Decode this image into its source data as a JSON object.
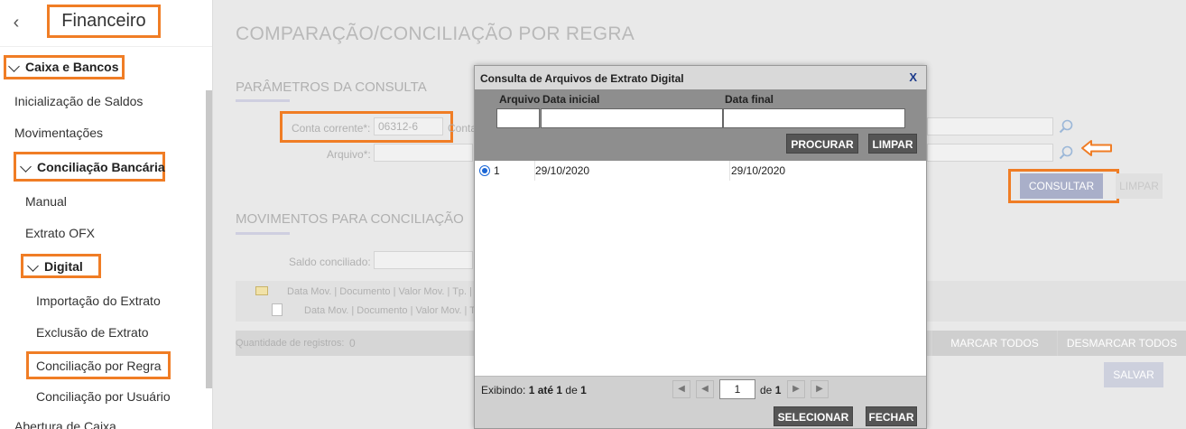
{
  "sidebar": {
    "title": "Financeiro",
    "items": [
      {
        "label": "Caixa e Bancos"
      },
      {
        "label": "Inicialização de Saldos"
      },
      {
        "label": "Movimentações"
      },
      {
        "label": "Conciliação Bancária"
      },
      {
        "label": "Manual"
      },
      {
        "label": "Extrato OFX"
      },
      {
        "label": "Digital"
      },
      {
        "label": "Importação do Extrato"
      },
      {
        "label": "Exclusão de Extrato"
      },
      {
        "label": "Conciliação por Regra"
      },
      {
        "label": "Conciliação por Usuário"
      },
      {
        "label": "Abertura de Caixa"
      }
    ]
  },
  "main": {
    "page_title": "COMPARAÇÃO/CONCILIAÇÃO POR REGRA",
    "params_title": "PARÂMETROS DA CONSULTA",
    "conta_label": "Conta corrente*:",
    "conta_value": "06312-6",
    "conta_label2": "Conta",
    "arquivo_label": "Arquivo*:",
    "consultar": "CONSULTAR",
    "limpar": "LIMPAR",
    "mov_title": "MOVIMENTOS PARA CONCILIAÇÃO",
    "saldo_label": "Saldo conciliado:",
    "tree_row1": "Data Mov. | Documento | Valor Mov. | Tp. | C",
    "tree_row2": "Data Mov. | Documento | Valor Mov. | T",
    "qtd_label": "Quantidade de registros:",
    "qtd_value": "0",
    "marcar_todos": "MARCAR TODOS",
    "desmarcar_todos": "DESMARCAR TODOS",
    "salvar": "SALVAR"
  },
  "modal": {
    "title": "Consulta de Arquivos de Extrato Digital",
    "close": "X",
    "col_arquivo": "Arquivo",
    "col_data_inicial": "Data inicial",
    "col_data_final": "Data final",
    "procurar": "PROCURAR",
    "limpar": "LIMPAR",
    "rows": [
      {
        "arquivo": "1",
        "data_inicial": "29/10/2020",
        "data_final": "29/10/2020"
      }
    ],
    "footer": {
      "exibindo": "Exibindo:",
      "range": "1 até 1",
      "de": "de",
      "total": "1",
      "page": "1",
      "of_label": "de",
      "of_total": "1"
    },
    "selecionar": "SELECIONAR",
    "fechar": "FECHAR"
  },
  "colors": {
    "highlight": "#f07d25",
    "accent": "#1d3b8c"
  }
}
